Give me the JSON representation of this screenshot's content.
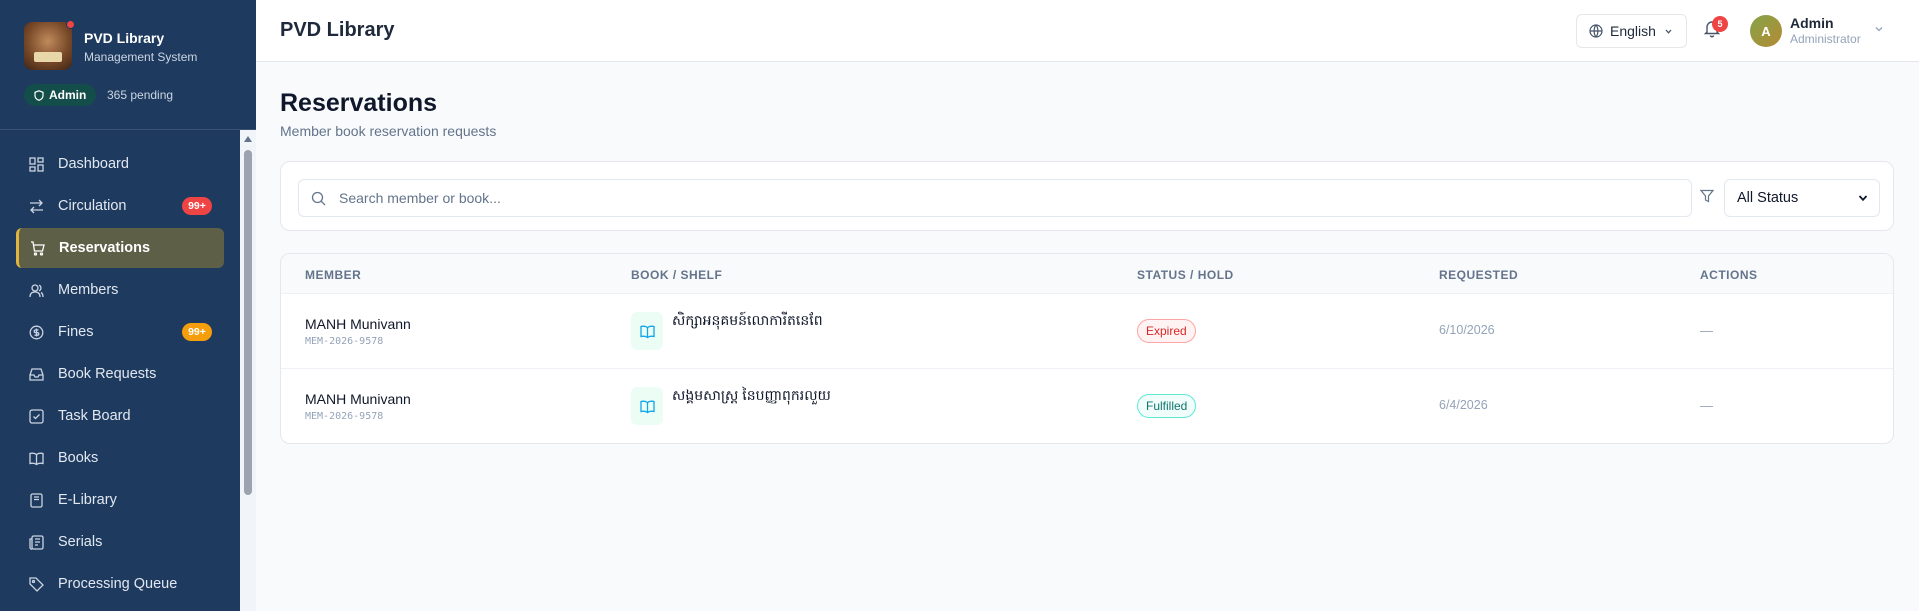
{
  "sidebar": {
    "brand_title": "PVD Library",
    "brand_subtitle": "Management System",
    "role_badge": "Admin",
    "pending": "365 pending",
    "items": [
      {
        "label": "Dashboard",
        "icon": "grid-icon"
      },
      {
        "label": "Circulation",
        "icon": "arrows-icon",
        "badge": "99+"
      },
      {
        "label": "Reservations",
        "icon": "cart-icon",
        "active": true
      },
      {
        "label": "Members",
        "icon": "users-icon"
      },
      {
        "label": "Fines",
        "icon": "coin-icon",
        "badge": "99+"
      },
      {
        "label": "Book Requests",
        "icon": "inbox-icon"
      },
      {
        "label": "Task Board",
        "icon": "checkbox-icon"
      },
      {
        "label": "Books",
        "icon": "book-open-icon"
      },
      {
        "label": "E-Library",
        "icon": "ebook-icon"
      },
      {
        "label": "Serials",
        "icon": "newspaper-icon"
      },
      {
        "label": "Processing Queue",
        "icon": "tag-icon"
      }
    ]
  },
  "header": {
    "title": "PVD Library",
    "language": "English",
    "notification_count": "5",
    "avatar_initial": "A",
    "user_name": "Admin",
    "user_role": "Administrator"
  },
  "main": {
    "title": "Reservations",
    "subtitle": "Member book reservation requests",
    "search_placeholder": "Search member or book...",
    "status_filter": "All Status",
    "columns": [
      "MEMBER",
      "BOOK / SHELF",
      "STATUS / HOLD",
      "REQUESTED",
      "ACTIONS"
    ],
    "rows": [
      {
        "member": "MANH Munivann",
        "member_id": "MEM-2026-9578",
        "book": "សិក្សាអនុគមន៍លោការីតនេពែ",
        "status": "Expired",
        "requested": "6/10/2026",
        "actions": "—"
      },
      {
        "member": "MANH Munivann",
        "member_id": "MEM-2026-9578",
        "book": "សង្គមសាស្ត្រ នៃបញ្ញាពុករលួយ",
        "status": "Fulfilled",
        "requested": "6/4/2026",
        "actions": "—"
      }
    ]
  },
  "colors": {
    "sidebar_bg": "#1e3a5f",
    "active_accent": "#e0b53f",
    "badge_red": "#ef4444",
    "badge_orange": "#f59e0b"
  }
}
